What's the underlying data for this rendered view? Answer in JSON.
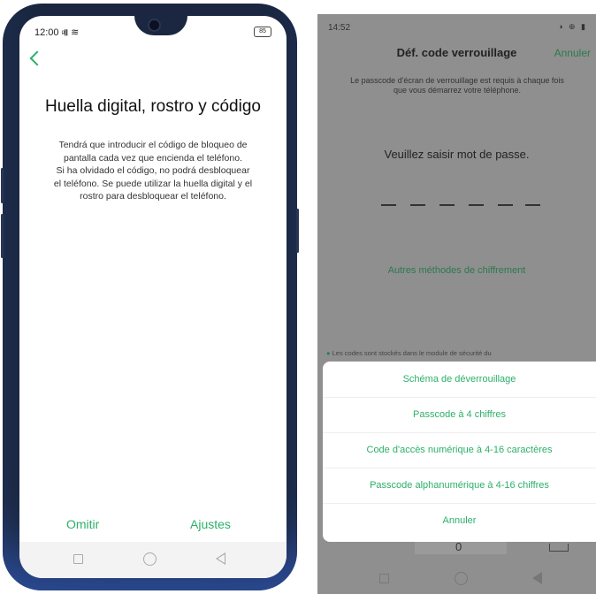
{
  "left_phone": {
    "status": {
      "time": "12:00",
      "signal": "ᵍ𝄃𝄃",
      "wifi": "≋",
      "battery": "85"
    },
    "title": "Huella digital, rostro y código",
    "description_lines": [
      "Tendrá que introducir el código de bloqueo de",
      "pantalla cada vez que encienda el teléfono.",
      "Si ha olvidado el código, no podrá desbloquear",
      "el teléfono. Se puede utilizar la huella digital y el",
      "rostro para desbloquear el teléfono."
    ],
    "footer": {
      "skip": "Omitir",
      "settings": "Ajustes"
    }
  },
  "right_screen": {
    "status": {
      "time": "14:52",
      "icons": "◑ ⊕ ▮"
    },
    "title": "Déf. code verrouillage",
    "cancel_top": "Annuler",
    "hint_lines": [
      "Le passcode d'écran de verrouillage est requis à chaque fois",
      "que vous démarrez votre téléphone."
    ],
    "prompt": "Veuillez saisir mot de passe.",
    "pin_length": 6,
    "other_methods": "Autres méthodes de chiffrement",
    "note": "Les codes sont stockés dans le module de sécurité du",
    "sheet": [
      "Schéma de déverrouillage",
      "Passcode à 4 chiffres",
      "Code d'accès numérique à 4-16 caractères",
      "Passcode alphanumérique à 4-16 chiffres",
      "Annuler"
    ],
    "key_under_sheet": "0"
  },
  "colors": {
    "accent_green": "#2bb06a",
    "dark_green": "#2b7a4f",
    "frame": "#1b2740",
    "overlay": "#8f8f8f"
  }
}
